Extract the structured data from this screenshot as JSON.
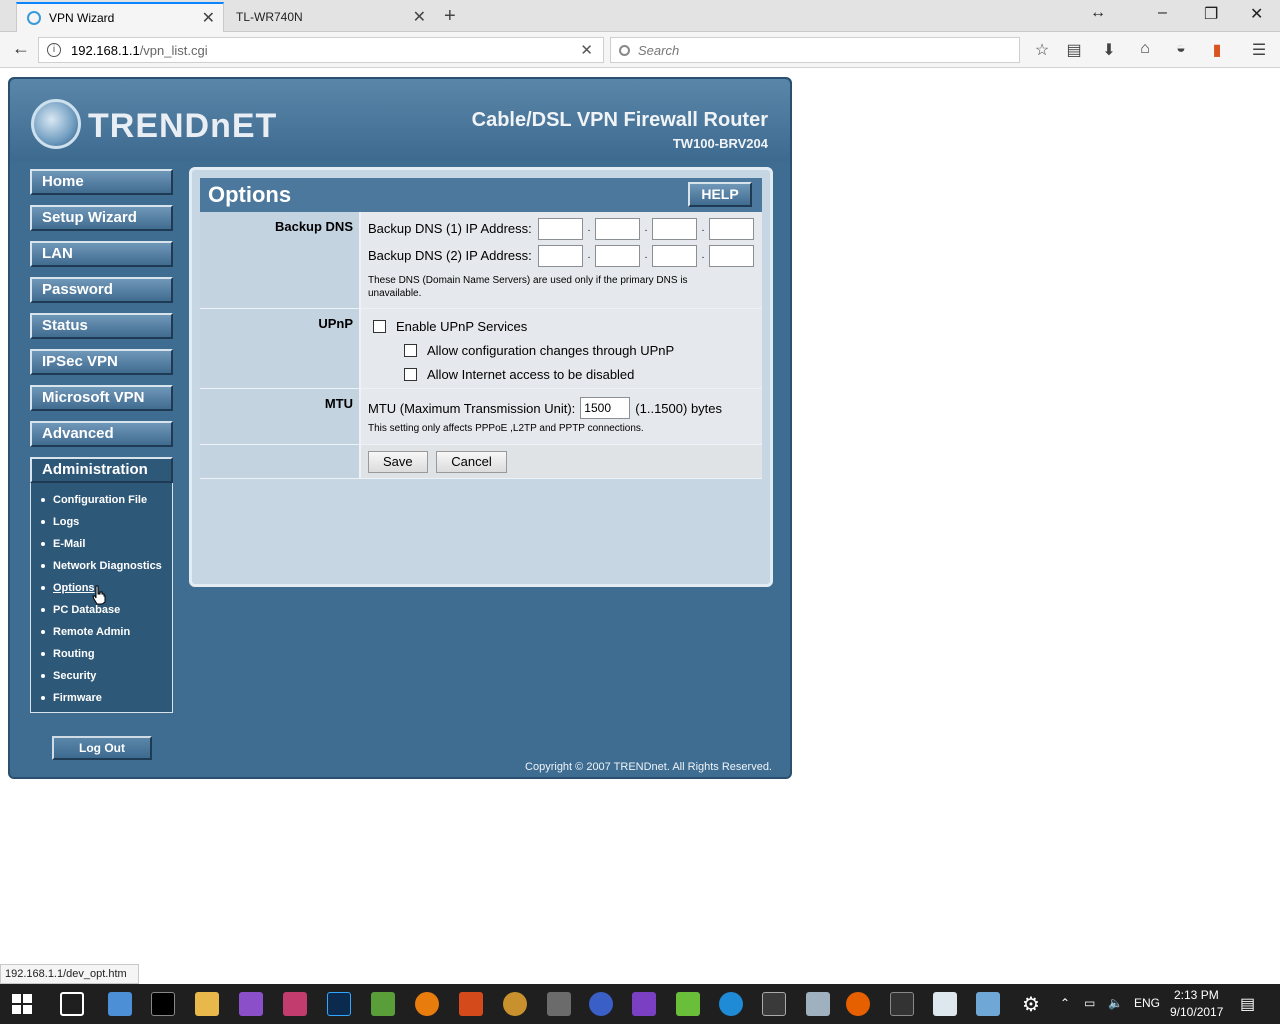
{
  "browser": {
    "tabs": [
      {
        "title": "VPN Wizard",
        "active": true
      },
      {
        "title": "TL-WR740N",
        "active": false
      }
    ],
    "url_host": "192.168.1.1",
    "url_path": "/vpn_list.cgi",
    "search_placeholder": "Search",
    "status_url": "192.168.1.1/dev_opt.htm"
  },
  "router": {
    "brand": "TRENDnET",
    "product_title": "Cable/DSL VPN Firewall Router",
    "model": "TW100-BRV204",
    "nav": [
      "Home",
      "Setup Wizard",
      "LAN",
      "Password",
      "Status",
      "IPSec VPN",
      "Microsoft VPN",
      "Advanced",
      "Administration"
    ],
    "admin_sub": [
      "Configuration File",
      "Logs",
      "E-Mail",
      "Network Diagnostics",
      "Options",
      "PC Database",
      "Remote Admin",
      "Routing",
      "Security",
      "Firmware"
    ],
    "logout_label": "Log Out",
    "copyright": "Copyright © 2007 TRENDnet. All Rights Reserved."
  },
  "options": {
    "title": "Options",
    "help_label": "HELP",
    "backup_dns": {
      "label": "Backup DNS",
      "dns1_label": "Backup DNS (1) IP Address:",
      "dns2_label": "Backup DNS (2) IP Address:",
      "note": "These DNS (Domain Name Servers) are used only if the primary DNS is unavailable."
    },
    "upnp": {
      "label": "UPnP",
      "enable": "Enable UPnP Services",
      "allow_config": "Allow configuration changes through UPnP",
      "allow_disable": "Allow Internet access to be disabled"
    },
    "mtu": {
      "label": "MTU",
      "field_label": "MTU (Maximum Transmission Unit):",
      "value": "1500",
      "range": "(1..1500) bytes",
      "note": "This setting only affects PPPoE ,L2TP and PPTP connections."
    },
    "save_label": "Save",
    "cancel_label": "Cancel"
  },
  "taskbar": {
    "time": "2:13 PM",
    "date": "9/10/2017",
    "lang": "ENG"
  }
}
